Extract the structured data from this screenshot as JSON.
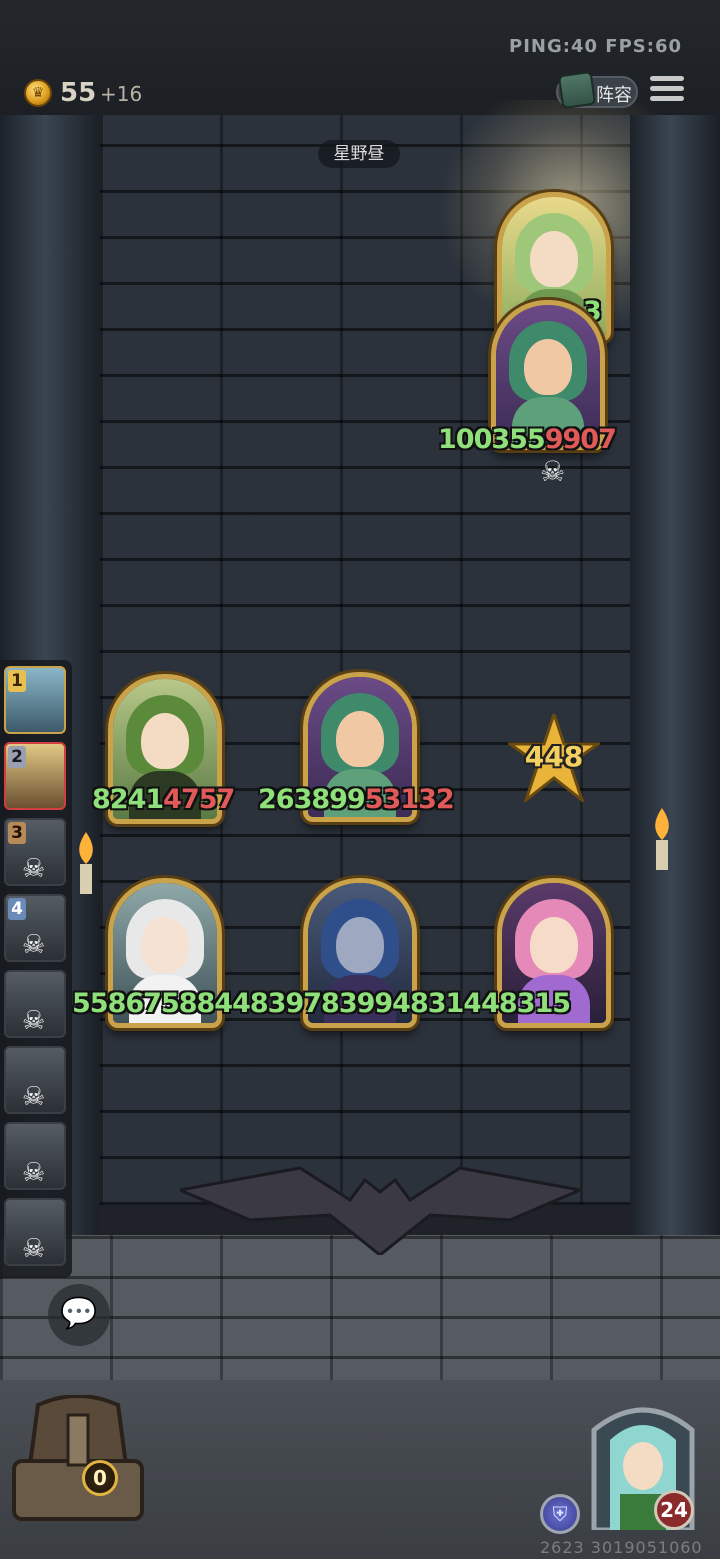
{
  "hud": {
    "ping_fps": "PING:40   FPS:60",
    "coins": "55",
    "coin_bonus": "+16",
    "lineup_label": "阵容",
    "opponent_name": "星野昼"
  },
  "enemy": {
    "cards": [
      {
        "name": "dryad-top",
        "hp_text": "3"
      },
      {
        "name": "dryad-boss",
        "hp_green": "100355",
        "hp_red": "9907"
      }
    ]
  },
  "board": {
    "row1": [
      {
        "name": "forest-elf",
        "hp_green": "8241",
        "hp_red": "4757"
      },
      {
        "name": "leaf-fairy",
        "hp_green": "263899",
        "hp_red": "53132"
      }
    ],
    "row2": [
      {
        "name": "white-priestess",
        "hp_green": "55867",
        "hp_extra": "58844"
      },
      {
        "name": "dark-elf",
        "hp_green": "8397",
        "hp_extra": "83994"
      },
      {
        "name": "lotus-girl",
        "hp_green": "8314",
        "hp_extra": "48315"
      }
    ],
    "damage": "448"
  },
  "queue": {
    "slots": [
      {
        "num": "1",
        "state": "active"
      },
      {
        "num": "2",
        "state": "selected"
      },
      {
        "num": "3",
        "state": "dead"
      },
      {
        "num": "4",
        "state": "dead"
      },
      {
        "num": "",
        "state": "dead"
      },
      {
        "num": "",
        "state": "dead"
      },
      {
        "num": "",
        "state": "dead"
      },
      {
        "num": "",
        "state": "dead"
      }
    ]
  },
  "bottom": {
    "chest_count": "0",
    "level": "24",
    "id_text": "2623 3019051060"
  },
  "colors": {
    "hp_green": "#8fe07a",
    "hp_red": "#e05a5a",
    "gold_frame": "#c9a24a"
  }
}
